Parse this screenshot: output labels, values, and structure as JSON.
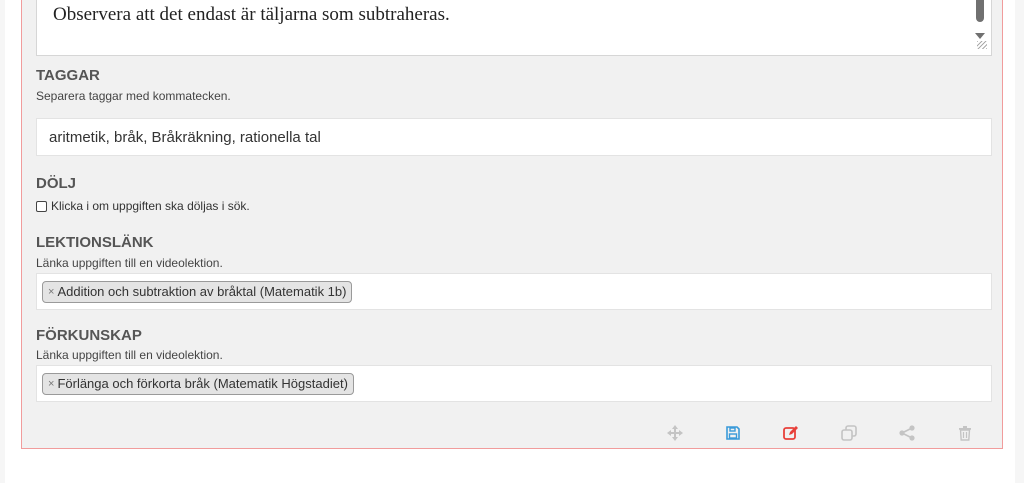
{
  "editor": {
    "text_content": "Observera att det endast är täljarna som subtraheras."
  },
  "tags": {
    "title": "TAGGAR",
    "help": "Separera taggar med kommatecken.",
    "value": "aritmetik, bråk, Bråkräkning, rationella tal"
  },
  "hide": {
    "title": "DÖLJ",
    "checkbox_label": "Klicka i om uppgiften ska döljas i sök.",
    "checked": false
  },
  "lesson_link": {
    "title": "LEKTIONSLÄNK",
    "help": "Länka uppgiften till en videolektion.",
    "chips": [
      "Addition och subtraktion av bråktal (Matematik 1b)"
    ]
  },
  "prerequisite": {
    "title": "FÖRKUNSKAP",
    "help": "Länka uppgiften till en videolektion.",
    "chips": [
      "Förlänga och förkorta bråk (Matematik Högstadiet)"
    ]
  },
  "chip_remove_symbol": "×",
  "toolbar": {
    "icons": [
      "move-icon",
      "save-icon",
      "edit-icon",
      "copy-icon",
      "share-icon",
      "trash-icon"
    ],
    "colors": {
      "muted": "#c4c4c4",
      "save": "#3a9ad9",
      "edit": "#e8403a"
    }
  }
}
